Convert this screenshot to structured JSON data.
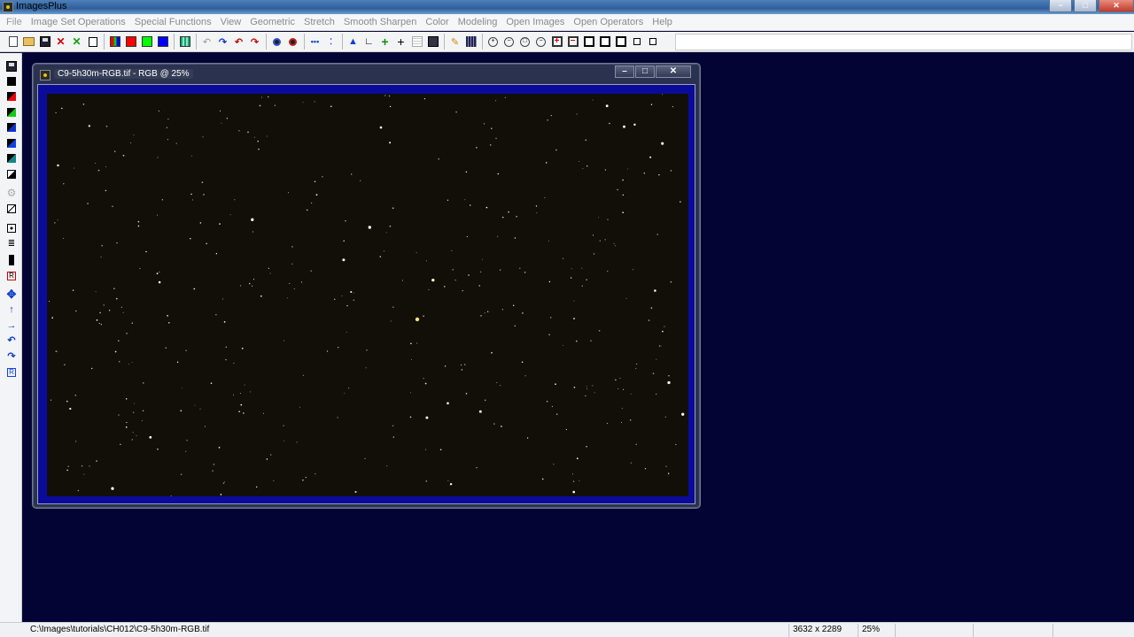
{
  "app": {
    "title": "ImagesPlus",
    "window_buttons": [
      "−",
      "□",
      "✕"
    ]
  },
  "menu": {
    "items": [
      "File",
      "Image Set Operations",
      "Special Functions",
      "View",
      "Geometric",
      "Stretch",
      "Smooth Sharpen",
      "Color",
      "Modeling",
      "Open Images",
      "Open Operators",
      "Help"
    ]
  },
  "toolbar": {
    "icons": [
      "new-icon",
      "open-folder-icon",
      "save-icon",
      "close-red-x-icon",
      "close-green-x-icon",
      "copy-icon",
      "rgb-channels-icon",
      "red-channel-icon",
      "green-channel-icon",
      "blue-channel-icon",
      "grid-icon",
      "undo-icon",
      "redo-icon",
      "undo-red-icon",
      "redo-red-icon",
      "circle-blue-icon",
      "circle-red-icon",
      "dotted-line-icon",
      "curve-points-icon",
      "histogram-icon",
      "ruler-icon",
      "green-plus-icon",
      "crosshair-icon",
      "table-icon",
      "camera-icon",
      "pencil-icon",
      "grid-dark-icon",
      "zoom-in-icon",
      "zoom-out-icon",
      "zoom-fit-icon",
      "zoom-actual-icon",
      "box-red-plus-icon",
      "box-red-minus-icon",
      "box-outline-1-icon",
      "box-outline-2-icon",
      "box-outline-3-icon",
      "box-outline-4-icon",
      "box-outline-5-icon"
    ]
  },
  "lefttools": {
    "icons": [
      "save-disk-icon",
      "black-square-icon",
      "red-black-square-icon",
      "green-black-square-icon",
      "blue-black-square-icon",
      "blue-black-square-2-icon",
      "teal-black-square-icon",
      "black-white-square-icon",
      "gear-icon",
      "diagonal-icon",
      "target-box-icon",
      "list-icon",
      "black-bar-icon",
      "crop-red-icon",
      "move-arrows-icon",
      "up-arrow-icon",
      "right-arrow-icon",
      "rotate-left-icon",
      "rotate-down-icon",
      "register-icon"
    ]
  },
  "child_window": {
    "title": "C9-5h30m-RGB.tif - RGB @ 25%",
    "buttons": [
      "–",
      "□",
      "✕"
    ]
  },
  "statusbar": {
    "path": "C:\\Images\\tutorials\\CH012\\C9-5h30m-RGB.tif",
    "dimensions": "3632 x 2289",
    "zoom": "25%"
  },
  "colors": {
    "workspace": "#040434",
    "image_border": "#0b0b9a",
    "sky": "#110f08"
  }
}
